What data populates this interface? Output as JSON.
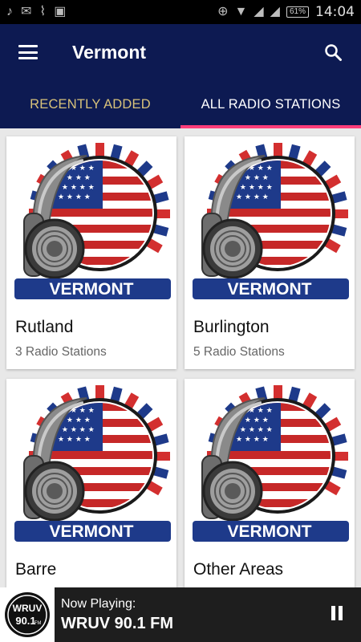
{
  "status_bar": {
    "time": "14:04",
    "battery": "61%",
    "left_icons": [
      "music-note-icon",
      "mail-icon",
      "broom-icon",
      "image-icon"
    ],
    "right_icons": [
      "data-saver-icon",
      "wifi-icon",
      "signal-icon",
      "signal-icon-2"
    ]
  },
  "toolbar": {
    "title": "Vermont",
    "menu_icon": "hamburger-menu-icon",
    "search_icon": "search-icon",
    "background": "#0d1a52"
  },
  "tabs": [
    {
      "label": "RECENTLY ADDED",
      "active": false
    },
    {
      "label": "ALL RADIO STATIONS",
      "active": true
    }
  ],
  "accent": "#ff3d7a",
  "cards": [
    {
      "image_text": "VERMONT",
      "name": "Rutland",
      "count": "3 Radio Stations"
    },
    {
      "image_text": "VERMONT",
      "name": "Burlington",
      "count": "5 Radio Stations"
    },
    {
      "image_text": "VERMONT",
      "name": "Barre",
      "count": ""
    },
    {
      "image_text": "VERMONT",
      "name": "Other Areas",
      "count": ""
    }
  ],
  "player": {
    "now_playing_label": "Now Playing:",
    "station": "WRUV 90.1 FM",
    "logo_text": "WRUV",
    "logo_freq": "90.1",
    "logo_band": "FM",
    "control_icon": "pause-icon"
  }
}
